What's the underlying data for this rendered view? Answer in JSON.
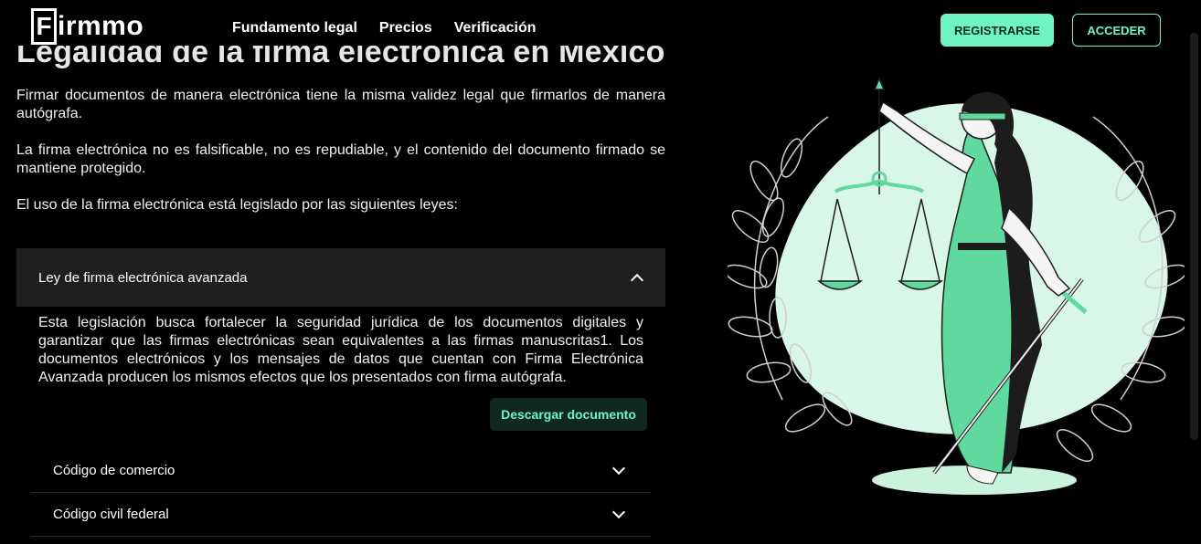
{
  "header": {
    "logo_first": "F",
    "logo_rest": "irmmo",
    "nav": [
      "Fundamento legal",
      "Precios",
      "Verificación"
    ],
    "register_label": "REGISTRARSE",
    "login_label": "ACCEDER"
  },
  "main": {
    "title": "Legalidad de la firma electrónica en México",
    "paragraphs": [
      "Firmar documentos de manera electrónica tiene la misma validez legal que firmarlos de manera autógrafa.",
      "La firma electrónica no es falsificable, no es repudiable, y el contenido del documento firmado se mantiene protegido.",
      "El uso de la firma electrónica está legislado por las siguientes leyes:"
    ],
    "accordion": {
      "open_item": {
        "label": "Ley de firma electrónica avanzada",
        "text": "Esta legislación busca fortalecer la seguridad jurídica de los documentos digitales y garantizar que las firmas electrónicas sean equivalentes a las firmas manuscritas1. Los documentos electrónicos y los mensajes de datos que cuentan con Firma Electrónica Avanzada producen los mismos efectos que los presentados con firma autógrafa.",
        "download_label": "Descargar documento"
      },
      "items": [
        "Código de comercio",
        "Código civil federal"
      ]
    }
  },
  "colors": {
    "accent": "#6ff5c3",
    "background": "#000000",
    "panel": "#1f1f1f",
    "illustration_green": "#5fd99e",
    "illustration_mint": "#d8f7e8"
  },
  "icons": [
    "chevron-up-icon",
    "chevron-down-icon",
    "scroll-thumb"
  ]
}
